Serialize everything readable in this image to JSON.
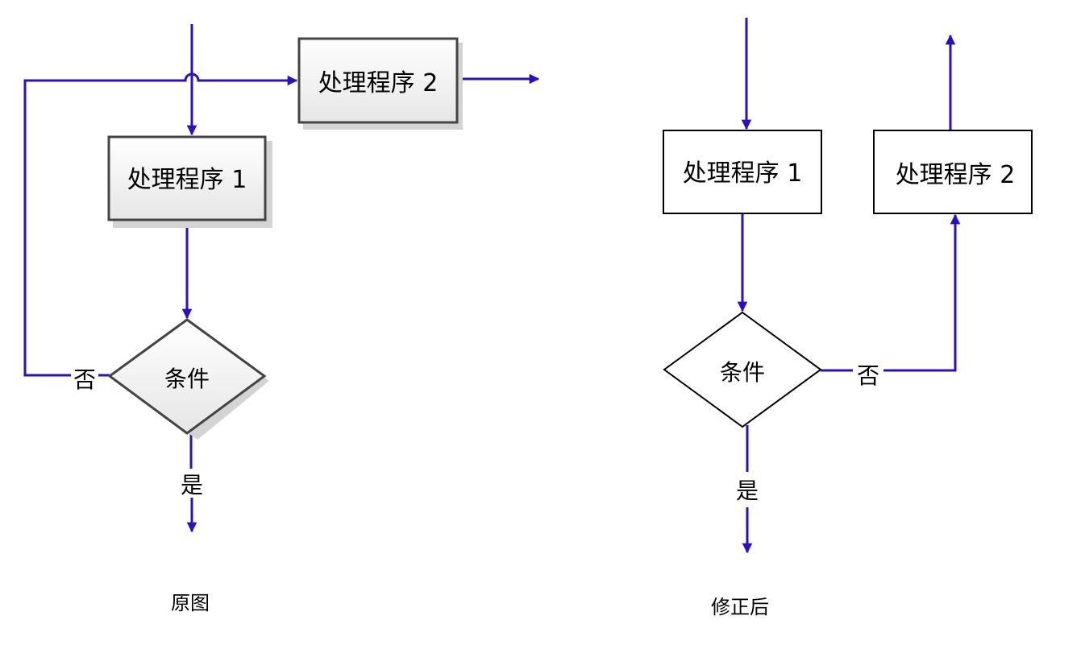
{
  "colors": {
    "line": "#2a10c0",
    "box_border_original": "#444444",
    "box_border_fixed": "#000000",
    "box_fill_top": "#ffffff",
    "box_fill_bottom": "#e8e8e8",
    "shadow": "#cfcfcf"
  },
  "original": {
    "caption": "原图",
    "process1": "处理程序 1",
    "process2": "处理程序 2",
    "condition": "条件",
    "no_label": "否",
    "yes_label": "是"
  },
  "fixed": {
    "caption": "修正后",
    "process1": "处理程序 1",
    "process2": "处理程序 2",
    "condition": "条件",
    "no_label": "否",
    "yes_label": "是"
  }
}
